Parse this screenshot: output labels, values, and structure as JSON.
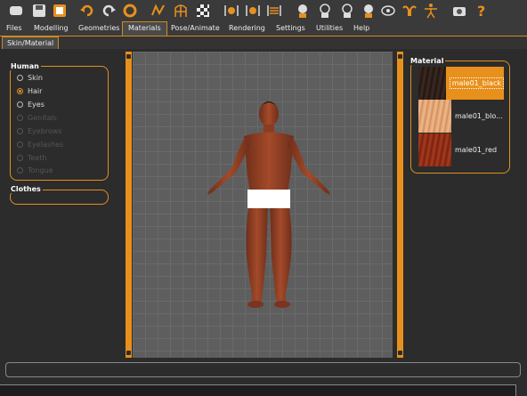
{
  "menu": {
    "tabs": [
      "Files",
      "Modelling",
      "Geometries",
      "Materials",
      "Pose/Animate",
      "Rendering",
      "Settings",
      "Utilities",
      "Help"
    ],
    "active": "Materials"
  },
  "subtab": {
    "label": "Skin/Material"
  },
  "human_group": {
    "title": "Human",
    "options": [
      {
        "label": "Skin",
        "state": "unchecked"
      },
      {
        "label": "Hair",
        "state": "checked"
      },
      {
        "label": "Eyes",
        "state": "unchecked"
      },
      {
        "label": "Genitals",
        "state": "disabled"
      },
      {
        "label": "Eyebrows",
        "state": "disabled"
      },
      {
        "label": "Eyelashes",
        "state": "disabled"
      },
      {
        "label": "Teeth",
        "state": "disabled"
      },
      {
        "label": "Tongue",
        "state": "disabled"
      }
    ]
  },
  "clothes_group": {
    "title": "Clothes"
  },
  "material_panel": {
    "title": "Material",
    "items": [
      {
        "name": "male01_black",
        "swatch": "#2a1c16",
        "selected": true
      },
      {
        "name": "male01_blo...",
        "swatch": "#e0a070",
        "selected": false
      },
      {
        "name": "male01_red",
        "swatch": "#8a2a14",
        "selected": false
      }
    ]
  },
  "colors": {
    "accent": "#e8901c",
    "background": "#2c2c2c",
    "viewport": "#5e5e5e"
  }
}
